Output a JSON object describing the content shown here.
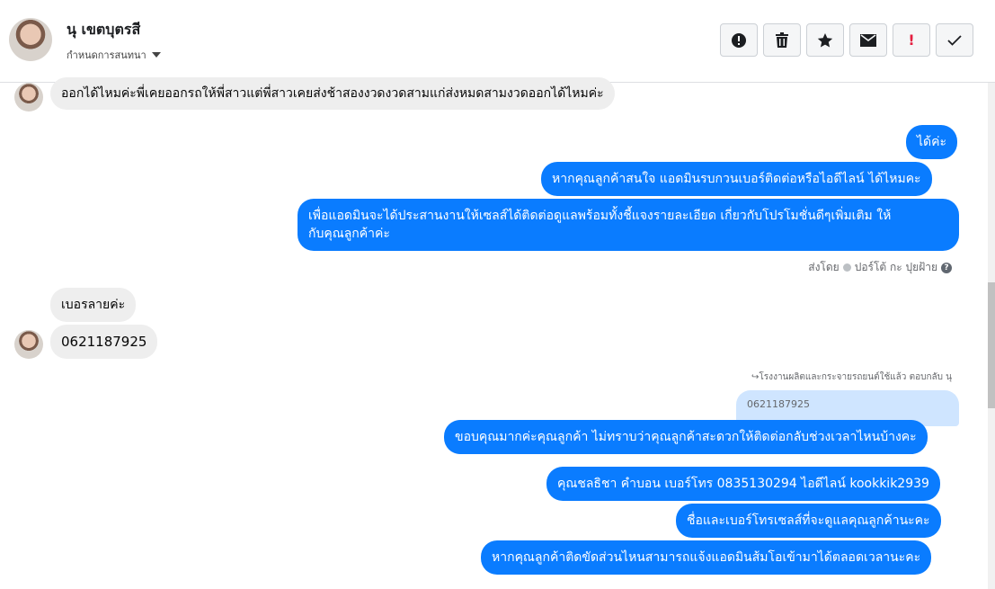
{
  "header": {
    "name": "นุ เขตบุตรสี",
    "subtitle": "กำหนดการสนทนา",
    "tools": [
      {
        "name": "alert-icon"
      },
      {
        "name": "trash-icon"
      },
      {
        "name": "star-icon"
      },
      {
        "name": "mail-icon"
      },
      {
        "name": "exclaim-icon",
        "label": "!"
      },
      {
        "name": "check-icon"
      }
    ]
  },
  "messages": {
    "m1": "ออกได้ไหมค่ะพี่เคยออกรถให้พี่สาวแต่พี่สาวเคยส่งช้าสองงวดงวดสามแก่ส่งหมดสามงวดออกได้ไหมค่ะ",
    "m2": "ได้ค่ะ",
    "m3": "หากคุณลูกค้าสนใจ แอดมินรบกวนเบอร์ติดต่อหรือไอดีไลน์ ได้ไหมคะ",
    "m4a": "เพื่อแอดมินจะได้ประสานงานให้เซลส์ได้ติดต่อดูแลพร้อมทั้งชี้แจงรายละเอียด เกี่ยวกับโปรโมชั่นดีๆเพิ่มเติม ให้",
    "m4b": "กับคุณลูกค้าค่ะ",
    "m5": "เบอรลายค่ะ",
    "m6": "0621187925",
    "m7": "ขอบคุณมากค่ะคุณลูกค้า ไม่ทราบว่าคุณลูกค้าสะดวกให้ติดต่อกลับช่วงเวลาไหนบ้างคะ",
    "m8": "คุณชลธิชา คำบอน เบอร์โทร 0835130294  ไอดีไลน์ kookkik2939",
    "m9": "ชื่อและเบอร์โทรเซลส์ที่จะดูแลคุณลูกค้านะคะ",
    "m10": "หากคุณลูกค้าติดขัดส่วนไหนสามารถแจ้งแอดมินส้มโอเข้ามาได้ตลอดเวลานะคะ"
  },
  "sent_by": {
    "prefix": "ส่งโดย",
    "name": "ปอร์โต้ กะ ปุยฝ้าย"
  },
  "reply_note": "โรงงานผลิตและกระจายรถยนต์ใช้แล้ว ตอบกลับ นุ",
  "quoted_text": "0621187925",
  "colors": {
    "outgoing": "#0a7cff",
    "incoming": "#eeeeee"
  }
}
